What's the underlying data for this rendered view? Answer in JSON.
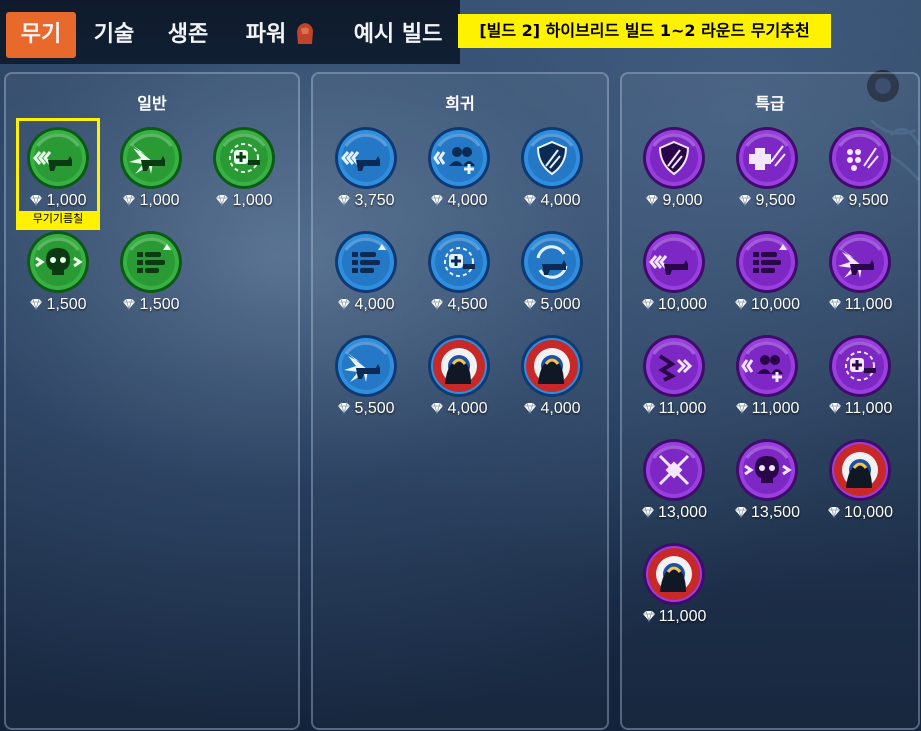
{
  "tabs": [
    {
      "label": "무기",
      "active": true
    },
    {
      "label": "기술",
      "active": false
    },
    {
      "label": "생존",
      "active": false
    },
    {
      "label": "파워",
      "active": false
    },
    {
      "label": "예시 빌드",
      "active": false
    }
  ],
  "banner": "[빌드 2] 하이브리드 빌드 1~2 라운드 무기추천",
  "highlight_label": "무기기름칠",
  "panels": [
    {
      "title": "일반",
      "color": "green",
      "items": [
        {
          "icon": "oil-weapon-icon",
          "price": "1,000"
        },
        {
          "icon": "burst-weapon-icon",
          "price": "1,000"
        },
        {
          "icon": "heal-weapon-icon",
          "price": "1,000"
        },
        {
          "icon": "skull-speed-icon",
          "price": "1,500"
        },
        {
          "icon": "ammo-list-icon",
          "price": "1,500"
        }
      ]
    },
    {
      "title": "희귀",
      "color": "blue",
      "items": [
        {
          "icon": "speed-weapon-icon",
          "price": "3,750"
        },
        {
          "icon": "team-speed-icon",
          "price": "4,000"
        },
        {
          "icon": "shield-speed-icon",
          "price": "4,000"
        },
        {
          "icon": "ammo-list-icon",
          "price": "4,000"
        },
        {
          "icon": "heal-weapon-icon",
          "price": "4,500"
        },
        {
          "icon": "reload-weapon-icon",
          "price": "5,000"
        },
        {
          "icon": "burst-weapon-icon",
          "price": "5,500"
        },
        {
          "icon": "hero-portrait-icon",
          "price": "4,000"
        },
        {
          "icon": "hero-portrait-icon",
          "price": "4,000"
        }
      ]
    },
    {
      "title": "특급",
      "color": "purple",
      "items": [
        {
          "icon": "shield-slash-icon",
          "price": "9,000"
        },
        {
          "icon": "heal-slash-icon",
          "price": "9,500"
        },
        {
          "icon": "dots-slash-icon",
          "price": "9,500"
        },
        {
          "icon": "speed-weapon-icon",
          "price": "10,000"
        },
        {
          "icon": "ammo-list-icon",
          "price": "10,000"
        },
        {
          "icon": "burst-weapon-icon",
          "price": "11,000"
        },
        {
          "icon": "claw-speed-icon",
          "price": "11,000"
        },
        {
          "icon": "team-heal-icon",
          "price": "11,000"
        },
        {
          "icon": "target-heal-icon",
          "price": "11,000"
        },
        {
          "icon": "cross-target-icon",
          "price": "13,000"
        },
        {
          "icon": "skull-bolt-icon",
          "price": "13,500"
        },
        {
          "icon": "hero-portrait-icon",
          "price": "10,000"
        },
        {
          "icon": "hero-portrait-icon",
          "price": "11,000"
        }
      ]
    }
  ],
  "colors": {
    "green": "#2fa23a",
    "blue": "#2f86d6",
    "purple": "#8a2fd0",
    "tab_active": "#e9682b",
    "banner": "#fff200"
  }
}
